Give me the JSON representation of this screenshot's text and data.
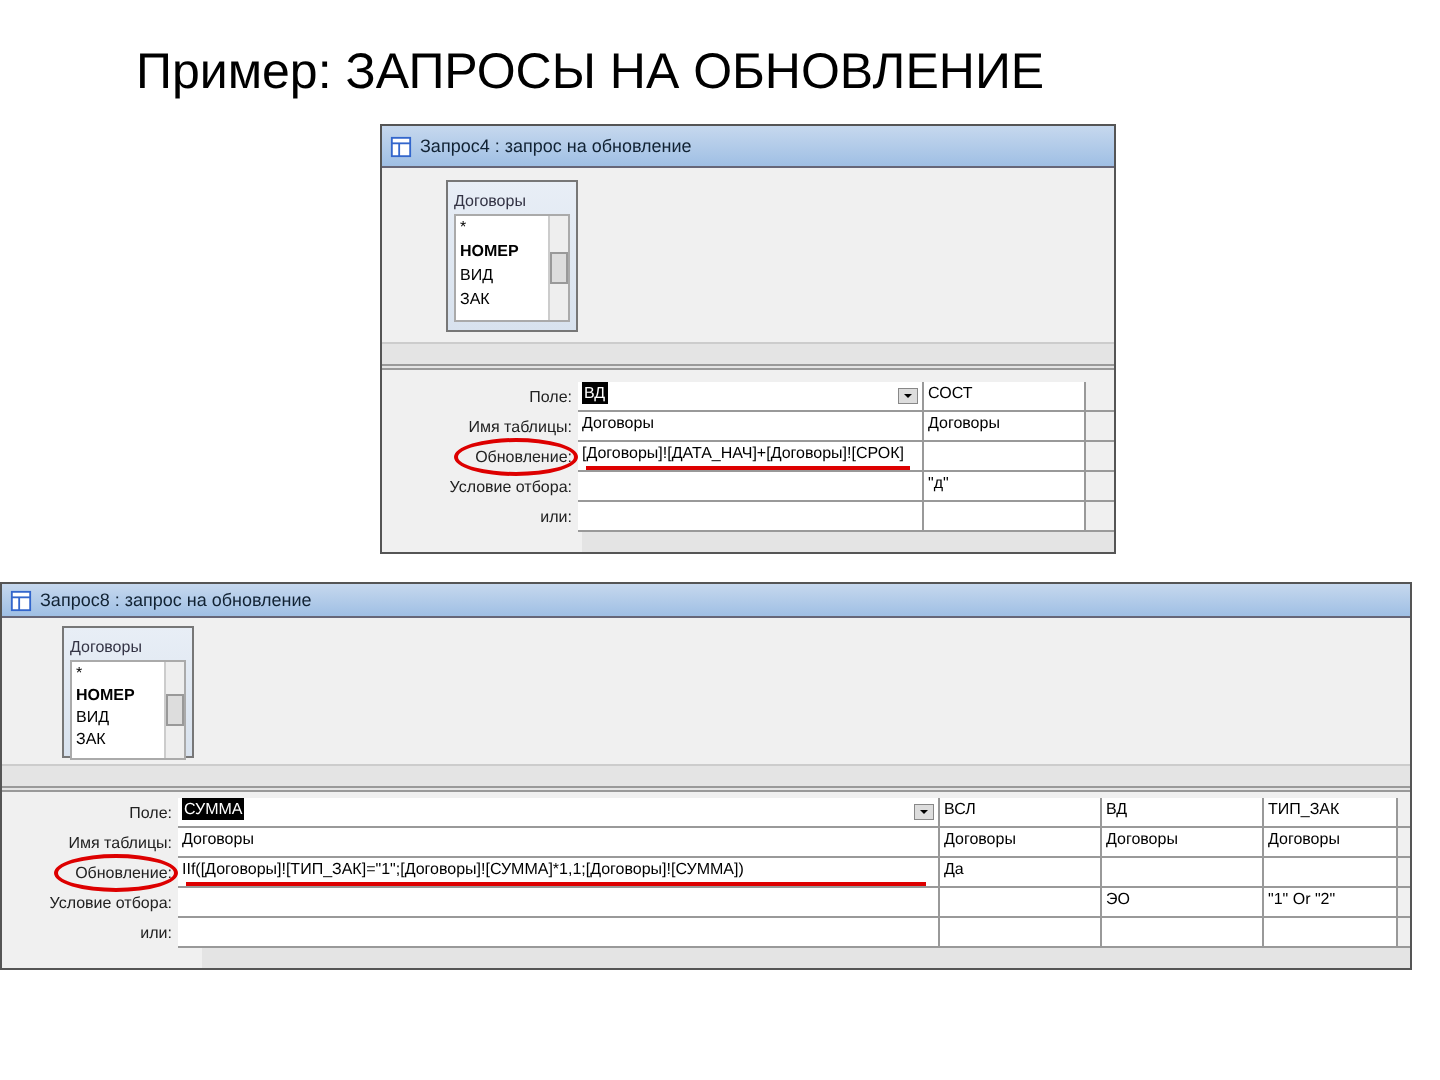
{
  "slide": {
    "title": "Пример: ЗАПРОСЫ НА ОБНОВЛЕНИЕ"
  },
  "windows": [
    {
      "kind": "narrow",
      "title": "Запрос4 : запрос на обновление",
      "table": {
        "name": "Договоры",
        "fields": [
          "*",
          "НОМЕР",
          "ВИД",
          "ЗАК"
        ]
      },
      "row_labels": [
        "Поле:",
        "Имя таблицы:",
        "Обновление:",
        "Условие отбора:",
        "или:"
      ],
      "columns": [
        {
          "selected": true,
          "cells": [
            "ВД",
            "Договоры",
            "[Договоры]![ДАТА_НАЧ]+[Договоры]![СРОК]",
            "",
            ""
          ]
        },
        {
          "selected": false,
          "cells": [
            "СОСТ",
            "Договоры",
            "",
            "\"д\"",
            ""
          ]
        }
      ]
    },
    {
      "kind": "wide",
      "title": "Запрос8 : запрос на обновление",
      "table": {
        "name": "Договоры",
        "fields": [
          "*",
          "НОМЕР",
          "ВИД",
          "ЗАК"
        ]
      },
      "row_labels": [
        "Поле:",
        "Имя таблицы:",
        "Обновление:",
        "Условие отбора:",
        "или:"
      ],
      "columns": [
        {
          "selected": true,
          "cells": [
            "СУММА",
            "Договоры",
            "IIf([Договоры]![ТИП_ЗАК]=\"1\";[Договоры]![СУММА]*1,1;[Договоры]![СУММА])",
            "",
            ""
          ]
        },
        {
          "selected": false,
          "cells": [
            "ВСЛ",
            "Договоры",
            "Да",
            "",
            ""
          ]
        },
        {
          "selected": false,
          "cells": [
            "ВД",
            "Договоры",
            "",
            "ЭО",
            ""
          ]
        },
        {
          "selected": false,
          "cells": [
            "ТИП_ЗАК",
            "Договоры",
            "",
            "\"1\" Or \"2\"",
            ""
          ]
        }
      ]
    }
  ]
}
